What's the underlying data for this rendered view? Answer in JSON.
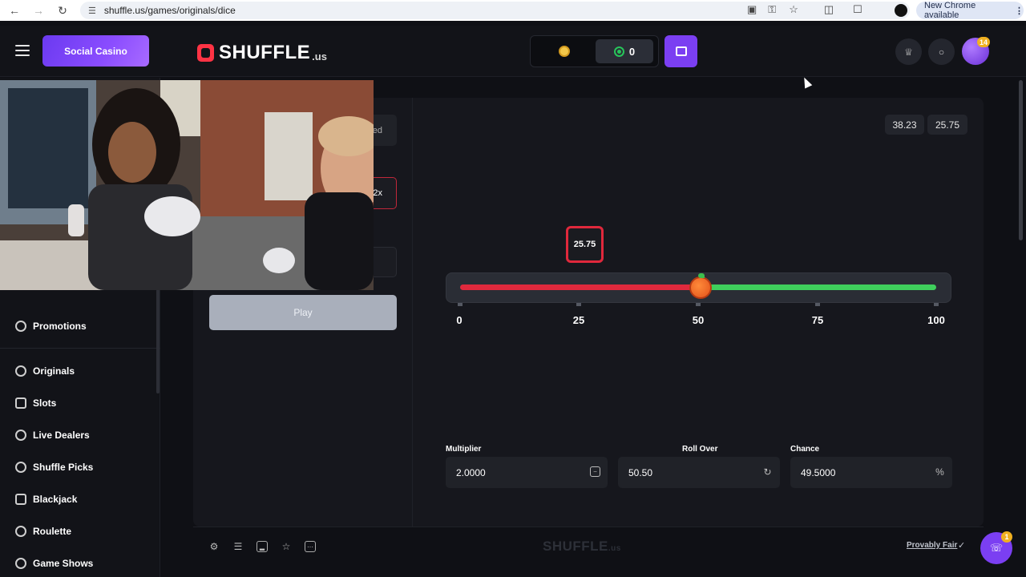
{
  "browser": {
    "url": "shuffle.us/games/originals/dice",
    "update_label": "New Chrome available",
    "icons": [
      "back-icon",
      "forward-icon",
      "reload-icon",
      "site-settings-icon",
      "install-icon",
      "password-key-icon",
      "bookmark-star-icon",
      "extensions-icon",
      "tab-search-icon",
      "profile-icon",
      "menu-dots-icon"
    ]
  },
  "header": {
    "social_casino_label": "Social Casino",
    "logo_text": "SHUFFLE",
    "logo_suffix": ".us",
    "gold_coins_balance": "0",
    "avatar_badge": "14"
  },
  "sidebar": {
    "promotions_label": "Promotions",
    "items": [
      {
        "label": "Originals",
        "icon": "originals-icon"
      },
      {
        "label": "Slots",
        "icon": "slots-icon"
      },
      {
        "label": "Live Dealers",
        "icon": "live-dealers-icon"
      },
      {
        "label": "Shuffle Picks",
        "icon": "shuffle-picks-icon"
      },
      {
        "label": "Blackjack",
        "icon": "blackjack-icon"
      },
      {
        "label": "Roulette",
        "icon": "roulette-icon"
      },
      {
        "label": "Game Shows",
        "icon": "game-shows-icon"
      }
    ]
  },
  "controls": {
    "stub1_text": "ed",
    "stub2_text": "2x",
    "play_label": "Play"
  },
  "game": {
    "history": [
      "38.23",
      "25.75"
    ],
    "result": "25.75",
    "roll_over_value": 50.5,
    "scale_ticks": [
      "0",
      "25",
      "50",
      "75",
      "100"
    ],
    "multiplier_label": "Multiplier",
    "multiplier_value": "2.0000",
    "roll_over_label": "Roll Over",
    "roll_over_field": "50.50",
    "chance_label": "Chance",
    "chance_value": "49.5000",
    "chance_suffix": "%",
    "colors": {
      "lose": "#e0293d",
      "win": "#3fcf5c",
      "accent": "#7b3ff2"
    }
  },
  "footer": {
    "logo_text": "SHUFFLE",
    "logo_suffix": ".us",
    "provably_fair_label": "Provably Fair",
    "support_badge": "1"
  }
}
